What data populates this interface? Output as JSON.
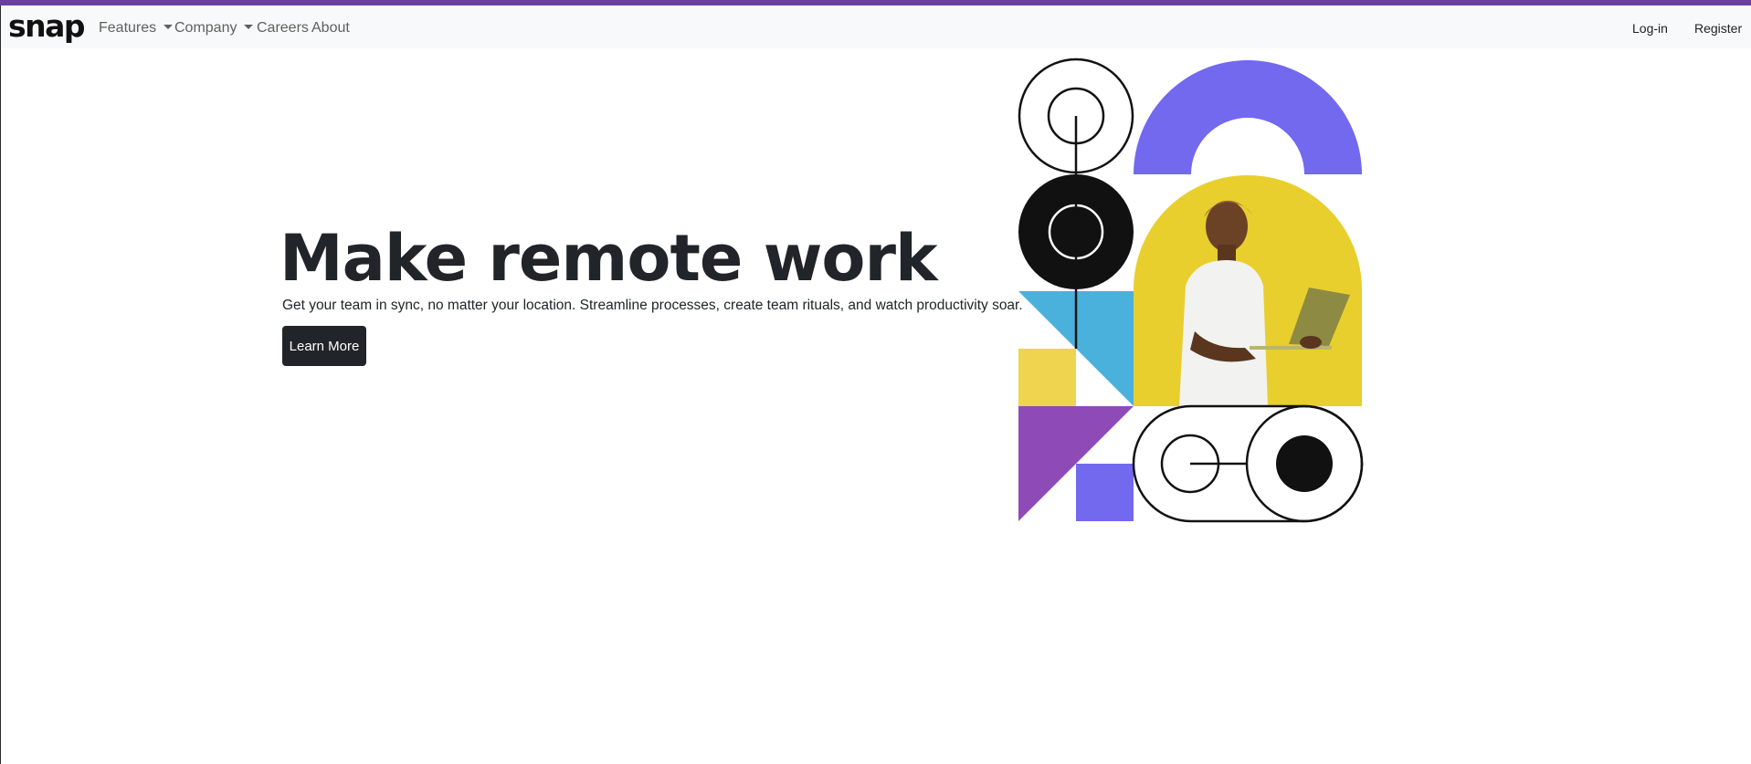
{
  "navbar": {
    "logo": "snap",
    "items": [
      {
        "label": "Features",
        "dropdown": true
      },
      {
        "label": "Company",
        "dropdown": true
      },
      {
        "label": "Careers",
        "dropdown": false
      },
      {
        "label": "About",
        "dropdown": false
      }
    ],
    "login_label": "Log-in",
    "register_label": "Register"
  },
  "hero": {
    "title": "Make remote work",
    "subtitle": "Get your team in sync, no matter your location. Streamline processes, create team rituals, and watch productivity soar.",
    "cta_label": "Learn More"
  },
  "colors": {
    "accent_bar": "#6b3fa0",
    "button_bg": "#212529",
    "shape_violet": "#7269ef",
    "shape_yellow": "#e8cf2e",
    "shape_blue": "#4ab0dc",
    "shape_purple": "#8e4bb8",
    "shape_light_yellow": "#efd44f"
  },
  "icons": [
    "caret-down-icon"
  ]
}
